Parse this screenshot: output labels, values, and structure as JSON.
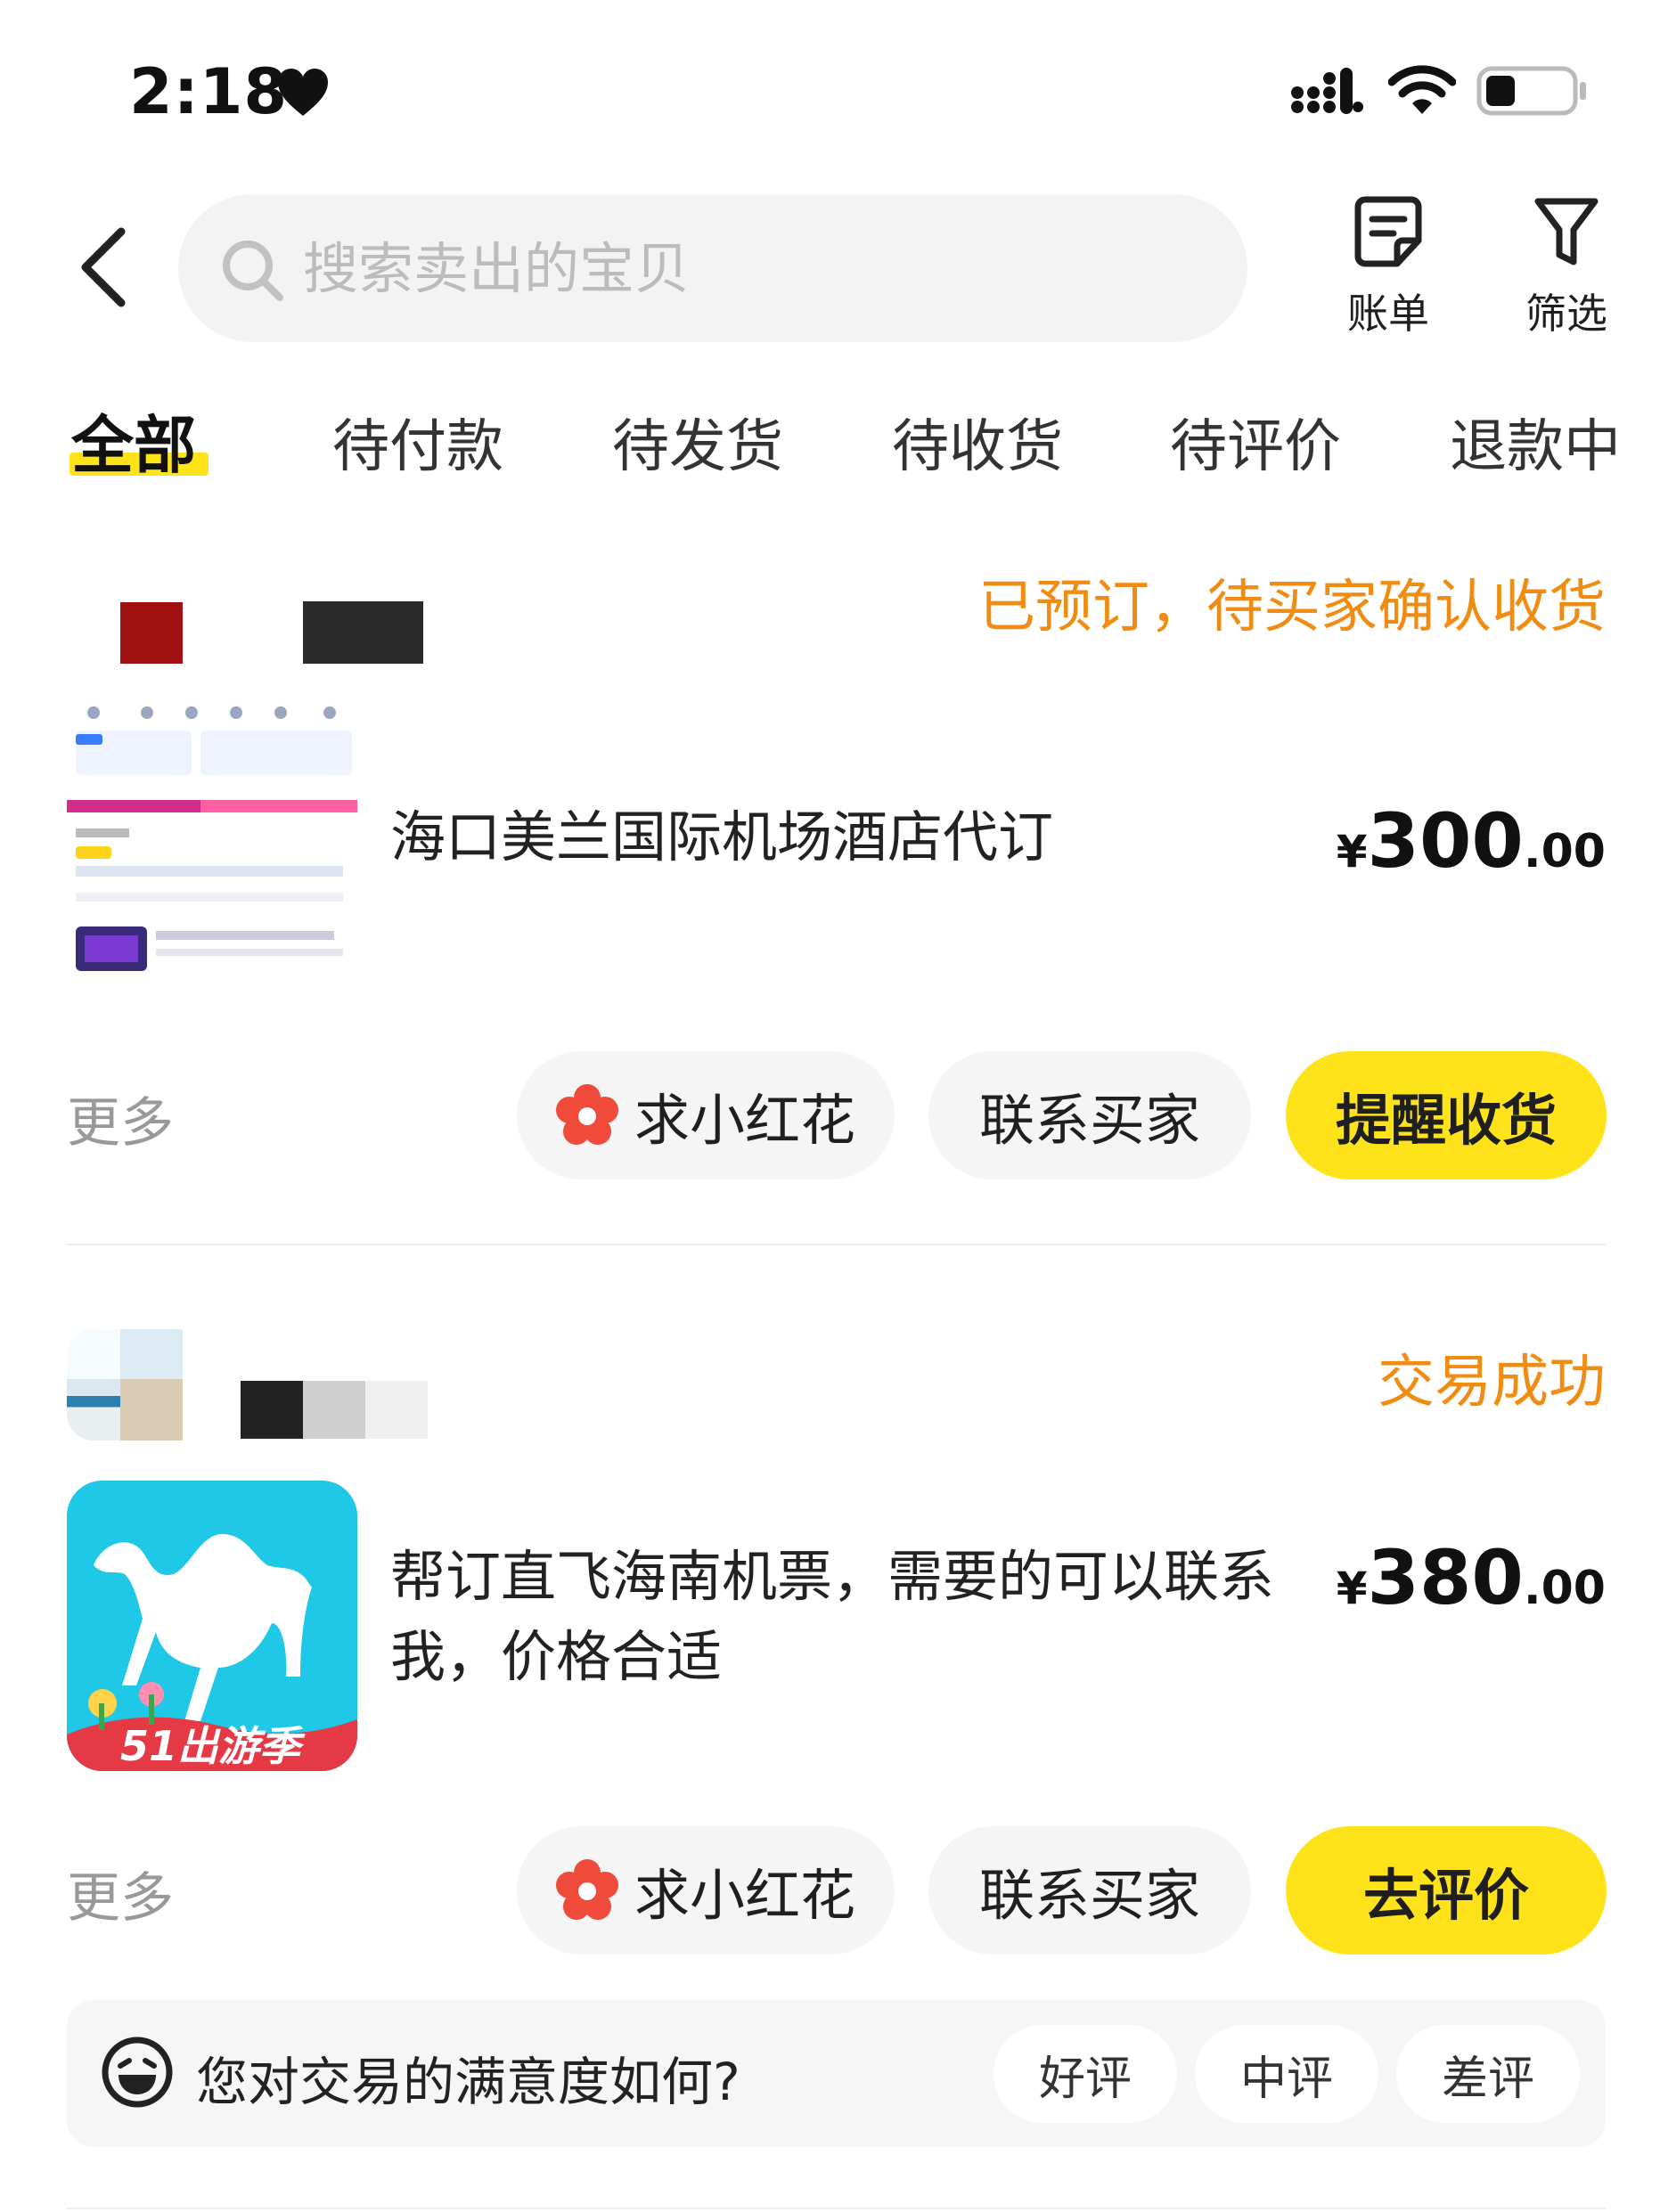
{
  "status_bar": {
    "time": "2:18"
  },
  "header": {
    "search_placeholder": "搜索卖出的宝贝",
    "bill_label": "账单",
    "filter_label": "筛选"
  },
  "tabs": [
    {
      "label": "全部",
      "active": true
    },
    {
      "label": "待付款",
      "active": false
    },
    {
      "label": "待发货",
      "active": false
    },
    {
      "label": "待收货",
      "active": false
    },
    {
      "label": "待评价",
      "active": false
    },
    {
      "label": "退款中",
      "active": false
    }
  ],
  "orders": [
    {
      "status": "已预订，待买家确认收货",
      "title": "海口美兰国际机场酒店代订",
      "price": {
        "currency": "¥",
        "integer": "300",
        "decimal": ".00"
      },
      "more": "更多",
      "buttons": {
        "flower": "求小红花",
        "contact": "联系买家",
        "primary": "提醒收货"
      }
    },
    {
      "status": "交易成功",
      "title_line1": "帮订直飞海南机票，需要的可以联系",
      "title_line2": "我，价格合适",
      "price": {
        "currency": "¥",
        "integer": "380",
        "decimal": ".00"
      },
      "more": "更多",
      "buttons": {
        "flower": "求小红花",
        "contact": "联系买家",
        "primary": "去评价"
      },
      "thumb_badge": "51出游季"
    }
  ],
  "satisfaction": {
    "question": "您对交易的满意度如何?",
    "options": [
      "好评",
      "中评",
      "差评"
    ]
  },
  "colors": {
    "accent_yellow": "#ffe31a",
    "status_orange": "#f08c12",
    "thumb_cyan": "#1ec8e6"
  }
}
